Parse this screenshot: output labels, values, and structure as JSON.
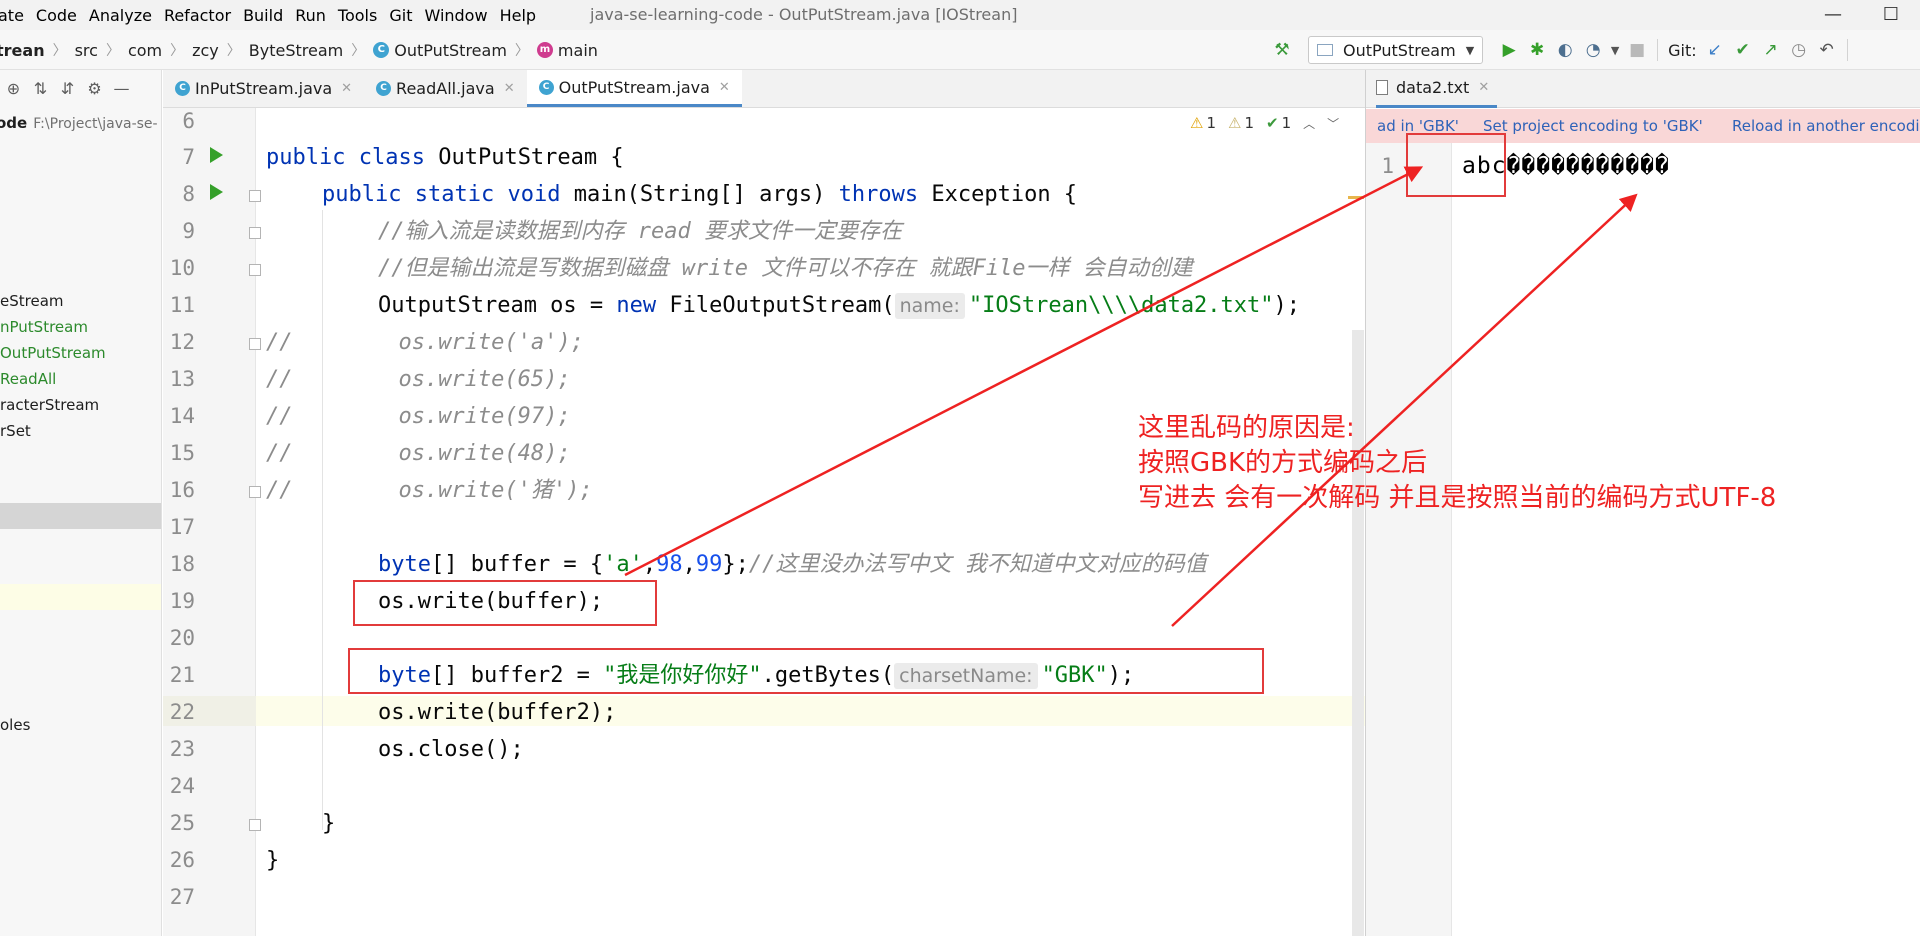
{
  "menu": [
    "ate",
    "Code",
    "Analyze",
    "Refactor",
    "Build",
    "Run",
    "Tools",
    "Git",
    "Window",
    "Help"
  ],
  "window_title": "java-se-learning-code - OutPutStream.java [IOStrean]",
  "window_controls": {
    "minimize": "—",
    "maximize": "☐"
  },
  "breadcrumb": [
    "trean",
    "src",
    "com",
    "zcy",
    "ByteStream",
    "OutPutStream",
    "main"
  ],
  "toolbar": {
    "run_config": "OutPutStream",
    "git_label": "Git:"
  },
  "project": {
    "root_name": "ode",
    "root_path": "F:\\Project\\java-se-",
    "items": [
      {
        "label": "eStream",
        "color": "dark"
      },
      {
        "label": "nPutStream",
        "color": "green"
      },
      {
        "label": "OutPutStream",
        "color": "green"
      },
      {
        "label": "ReadAll",
        "color": "green"
      },
      {
        "label": "racterStream",
        "color": "dark"
      },
      {
        "label": "rSet",
        "color": "dark"
      },
      {
        "label": "oles",
        "color": "dark"
      }
    ]
  },
  "tabs": [
    {
      "label": "InPutStream.java",
      "active": false
    },
    {
      "label": "ReadAll.java",
      "active": false
    },
    {
      "label": "OutPutStream.java",
      "active": true
    }
  ],
  "inspections": {
    "warnings": "1",
    "weak_warnings": "1",
    "typos": "1"
  },
  "line_numbers": [
    "6",
    "7",
    "8",
    "9",
    "10",
    "11",
    "12",
    "13",
    "14",
    "15",
    "16",
    "17",
    "18",
    "19",
    "20",
    "21",
    "22",
    "23",
    "24",
    "25",
    "26",
    "27"
  ],
  "code": {
    "l7_public": "public",
    "l7_class": "class",
    "l7_name": "OutPutStream {",
    "l8_public": "public",
    "l8_static": "static",
    "l8_void": "void",
    "l8_sig": "main(String[] args)",
    "l8_throws": "throws",
    "l8_exc": "Exception {",
    "l9": "//输入流是读数据到内存 read 要求文件一定要存在",
    "l10": "//但是输出流是写数据到磁盘 write 文件可以不存在 就跟File一样 会自动创建",
    "l11_pre": "OutputStream os = ",
    "l11_new": "new",
    "l11_call": " FileOutputStream(",
    "l11_hint": "name:",
    "l11_str": "\"IOStrean\\\\\\\\data2.txt\"",
    "l11_end": ");",
    "l12": "//        os.write('a');",
    "l13": "//        os.write(65);",
    "l14": "//        os.write(97);",
    "l15": "//        os.write(48);",
    "l16": "//        os.write('猪');",
    "l18_byte": "byte",
    "l18_a": "[] buffer = {",
    "l18_c": "'a'",
    "l18_d": ",",
    "l18_n1": "98",
    "l18_e": ",",
    "l18_n2": "99",
    "l18_f": "};",
    "l18_cm": "//这里没办法写中文 我不知道中文对应的码值",
    "l19": "os.write(buffer);",
    "l21_byte": "byte",
    "l21_a": "[] buffer2 = ",
    "l21_str": "\"我是你好你好\"",
    "l21_b": ".getBytes(",
    "l21_hint": "charsetName:",
    "l21_str2": "\"GBK\"",
    "l21_end": ");",
    "l22": "os.write(buffer2);",
    "l23": "os.close();",
    "l25": "}",
    "l26": "}"
  },
  "right_editor": {
    "tab": "data2.txt",
    "banner": [
      "ad in 'GBK'",
      "Set project encoding to 'GBK'",
      "Reload in another encoding"
    ],
    "line_number": "1",
    "content": "abc�����������"
  },
  "annotation": {
    "line1": "这里乱码的原因是:",
    "line2": "按照GBK的方式编码之后",
    "line3": "写进去 会有一次解码 并且是按照当前的编码方式UTF-8"
  },
  "annotation_color": "#ee2222"
}
